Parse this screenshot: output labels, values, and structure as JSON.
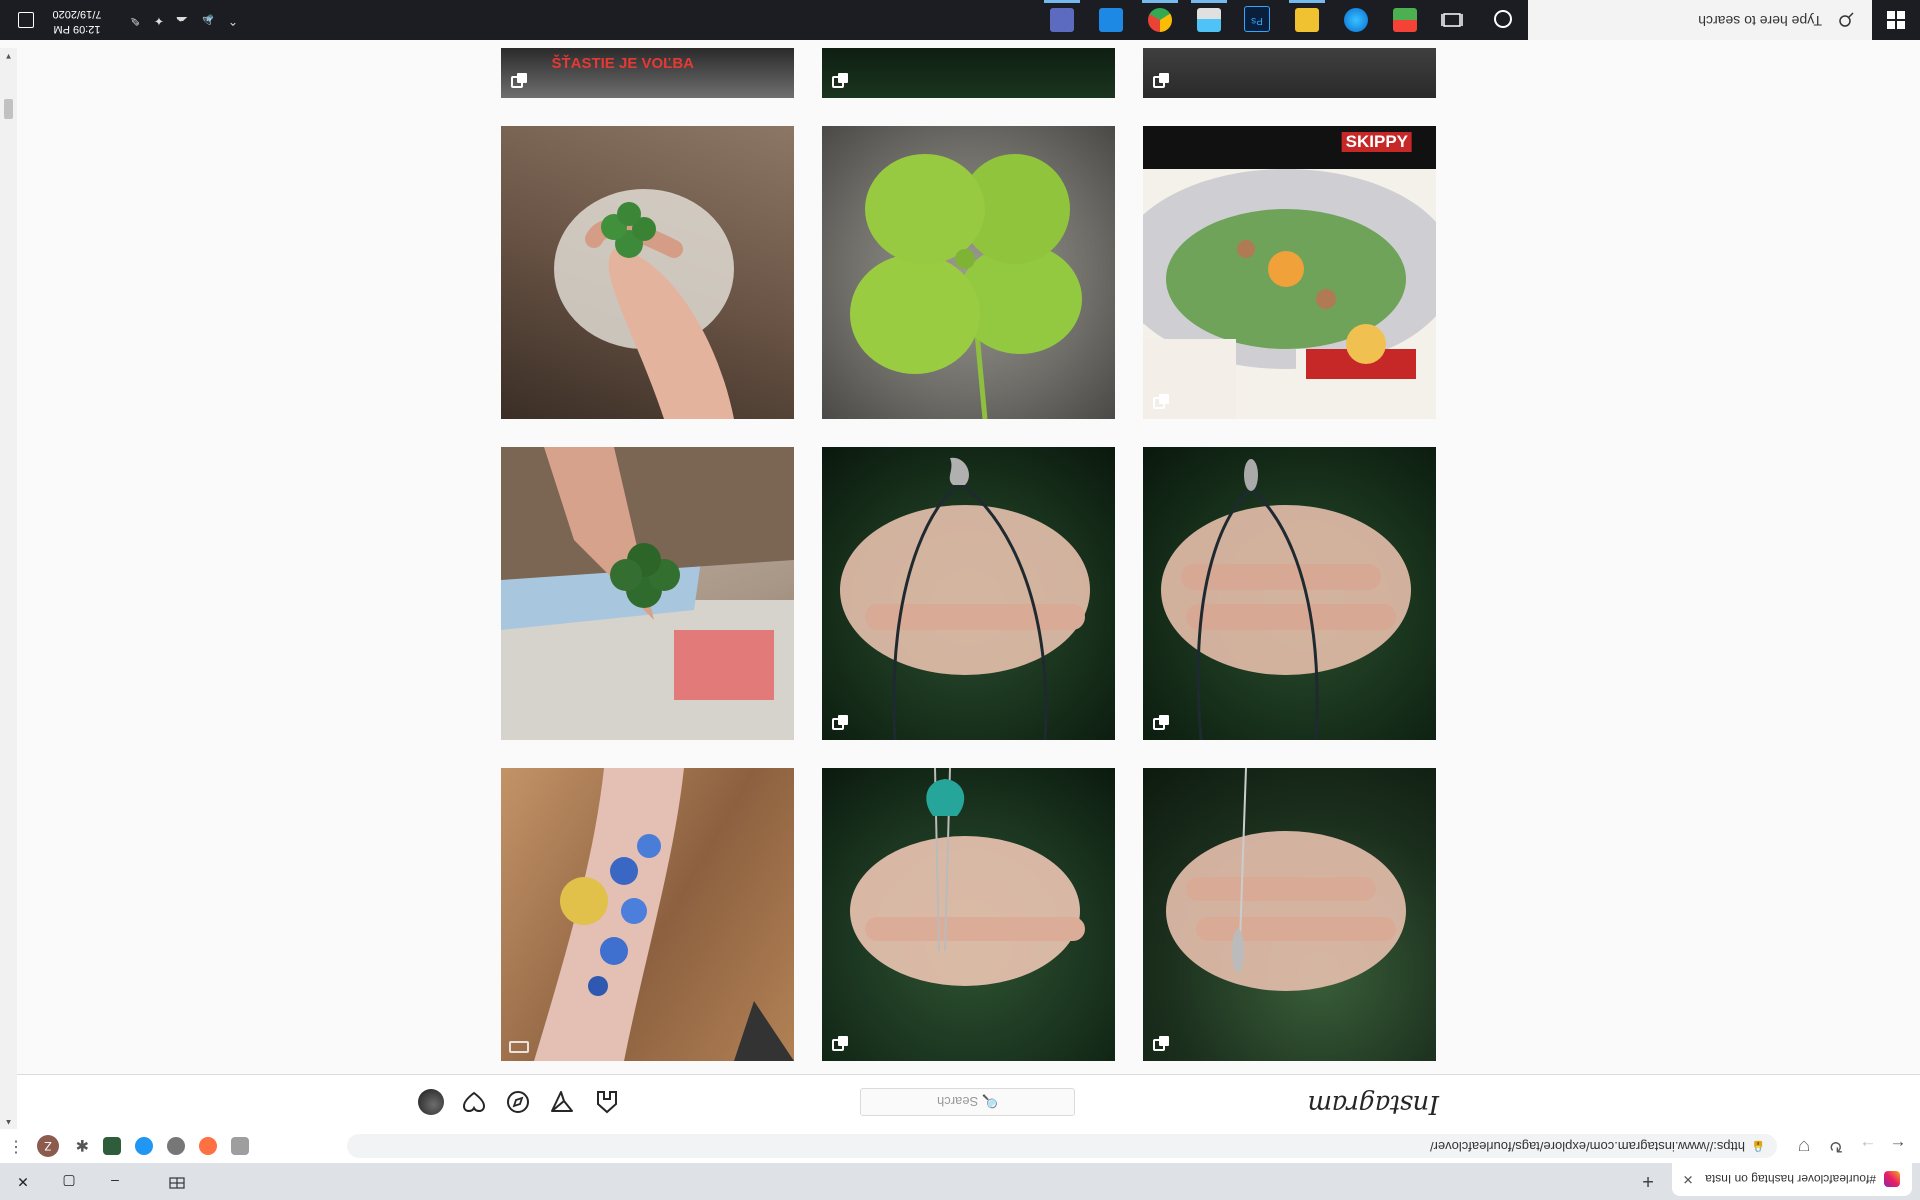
{
  "browser": {
    "tab_title": "#fourleafclover hashtag on Insta",
    "tab_close": "✕",
    "new_tab": "+",
    "url": "https://www.instagram.com/explore/tags/fourleafclover/",
    "profile_initial": "Z",
    "window_controls": {
      "minimize": "–",
      "maximize": "▢",
      "close": "✕"
    }
  },
  "instagram": {
    "logo": "Instagram",
    "search_placeholder": "🔍 Search",
    "posts": [
      {
        "row": 0,
        "col": 0,
        "subject": "hand with silver leaf pendant necklace",
        "badge": "multi"
      },
      {
        "row": 0,
        "col": 1,
        "subject": "hand with teal heart pendant necklace",
        "badge": "multi"
      },
      {
        "row": 0,
        "col": 2,
        "subject": "blue flower tattoo on arm",
        "badge": "carousel"
      },
      {
        "row": 1,
        "col": 0,
        "subject": "hand with pendant on black cord",
        "badge": "multi"
      },
      {
        "row": 1,
        "col": 1,
        "subject": "hand with dolphin pendant on black cord",
        "badge": "multi"
      },
      {
        "row": 1,
        "col": 2,
        "subject": "hand holding four leaf clover over chalk",
        "badge": "none"
      },
      {
        "row": 2,
        "col": 0,
        "subject": "illustrated food with Japanese text",
        "badge": "multi",
        "caption": "SKIPPY"
      },
      {
        "row": 2,
        "col": 1,
        "subject": "four leaf clover on granite",
        "badge": "none"
      },
      {
        "row": 2,
        "col": 2,
        "subject": "fingers holding four leaf clover",
        "badge": "none"
      }
    ],
    "top_row_caption": "ŠŤASTIE JE VOĽBA"
  },
  "taskbar": {
    "search_placeholder": "Type here to search",
    "time": "12:09 PM",
    "date": "7/19/2020"
  },
  "colors": {
    "page_bg": "#fafafa",
    "taskbar_bg": "#1b1d22",
    "accent_red": "#e53935"
  }
}
